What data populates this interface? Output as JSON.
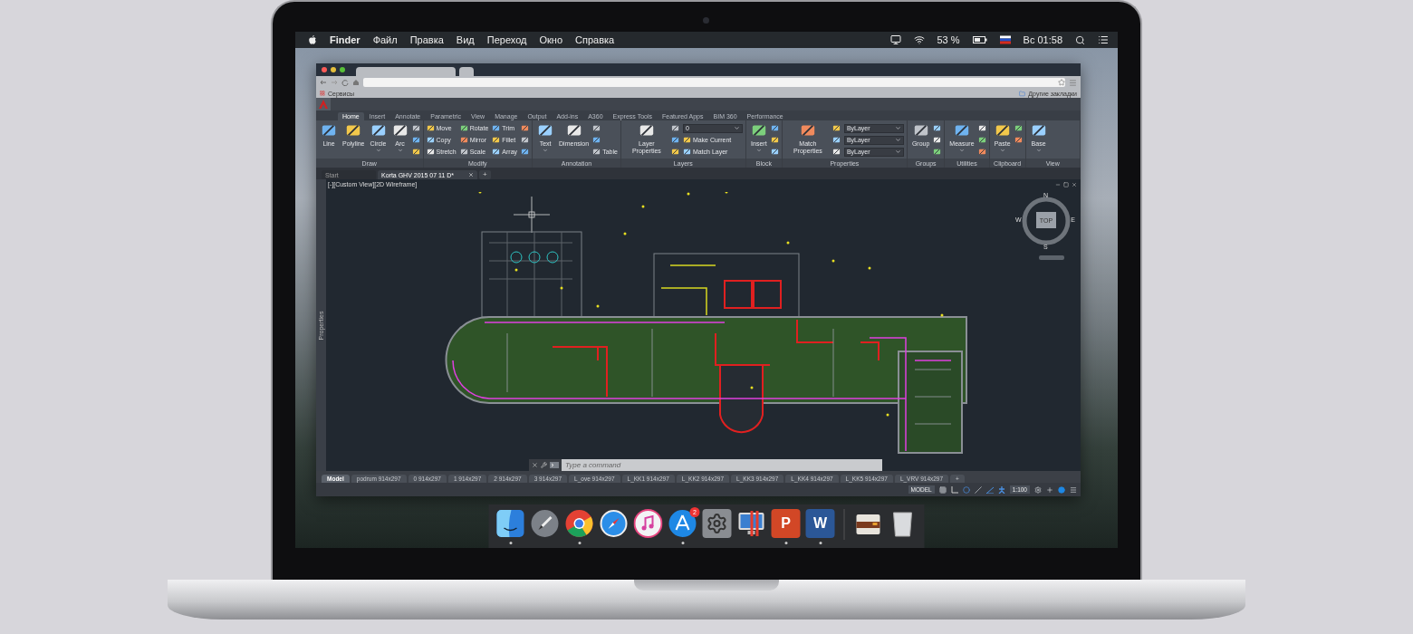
{
  "menu_bar": {
    "items": [
      {
        "label": "Finder",
        "kind": "app"
      },
      {
        "label": "Файл",
        "kind": "menu"
      },
      {
        "label": "Правка",
        "kind": "menu"
      },
      {
        "label": "Вид",
        "kind": "menu"
      },
      {
        "label": "Переход",
        "kind": "menu"
      },
      {
        "label": "Окно",
        "kind": "menu"
      },
      {
        "label": "Справка",
        "kind": "menu"
      }
    ],
    "battery": "53 %",
    "clock": "Вс 01:58"
  },
  "browser": {
    "bookmarks": [
      {
        "label": "Сервисы"
      }
    ],
    "other_bookmarks": "Другие закладки"
  },
  "autocad": {
    "ribbon_tabs": [
      {
        "label": "Home",
        "selected": true
      },
      {
        "label": "Insert",
        "selected": false
      },
      {
        "label": "Annotate",
        "selected": false
      },
      {
        "label": "Parametric",
        "selected": false
      },
      {
        "label": "View",
        "selected": false
      },
      {
        "label": "Manage",
        "selected": false
      },
      {
        "label": "Output",
        "selected": false
      },
      {
        "label": "Add-ins",
        "selected": false
      },
      {
        "label": "A360",
        "selected": false
      },
      {
        "label": "Express Tools",
        "selected": false
      },
      {
        "label": "Featured Apps",
        "selected": false
      },
      {
        "label": "BIM 360",
        "selected": false
      },
      {
        "label": "Performance",
        "selected": false
      }
    ],
    "panels": [
      {
        "title": "Draw",
        "items": [
          {
            "kind": "large",
            "label": "Line",
            "menu": false
          },
          {
            "kind": "large",
            "label": "Polyline",
            "menu": false
          },
          {
            "kind": "large",
            "label": "Circle",
            "menu": true
          },
          {
            "kind": "large",
            "label": "Arc",
            "menu": true
          },
          {
            "kind": "icon"
          },
          {
            "kind": "icon"
          },
          {
            "kind": "icon"
          }
        ]
      },
      {
        "title": "Modify",
        "items": [
          {
            "kind": "small",
            "label": "Move"
          },
          {
            "kind": "small",
            "label": "Copy"
          },
          {
            "kind": "small",
            "label": "Stretch"
          },
          {
            "kind": "small",
            "label": "Rotate"
          },
          {
            "kind": "small",
            "label": "Mirror"
          },
          {
            "kind": "small",
            "label": "Scale"
          },
          {
            "kind": "small",
            "label": "Trim"
          },
          {
            "kind": "small",
            "label": "Fillet"
          },
          {
            "kind": "small",
            "label": "Array"
          },
          {
            "kind": "icon"
          },
          {
            "kind": "icon"
          },
          {
            "kind": "icon"
          }
        ]
      },
      {
        "title": "Annotation",
        "items": [
          {
            "kind": "large",
            "label": "Text",
            "menu": true
          },
          {
            "kind": "large",
            "label": "Dimension",
            "menu": false
          },
          {
            "kind": "icon"
          },
          {
            "kind": "icon"
          },
          {
            "kind": "small",
            "label": "Table"
          }
        ]
      },
      {
        "title": "Layers",
        "items": [
          {
            "kind": "large",
            "label": "Layer Properties",
            "menu": false
          },
          {
            "kind": "icon"
          },
          {
            "kind": "icon"
          },
          {
            "kind": "icon"
          },
          {
            "kind": "dropdown",
            "label": "0"
          },
          {
            "kind": "small",
            "label": "Make Current"
          },
          {
            "kind": "small",
            "label": "Match Layer"
          }
        ]
      },
      {
        "title": "Block",
        "items": [
          {
            "kind": "large",
            "label": "Insert",
            "menu": true
          },
          {
            "kind": "icon"
          },
          {
            "kind": "icon"
          },
          {
            "kind": "icon"
          }
        ]
      },
      {
        "title": "Properties",
        "items": [
          {
            "kind": "large",
            "label": "Match Properties",
            "menu": false
          },
          {
            "kind": "icon"
          },
          {
            "kind": "icon"
          },
          {
            "kind": "icon"
          },
          {
            "kind": "dropdown",
            "label": "ByLayer"
          },
          {
            "kind": "dropdown",
            "label": "ByLayer"
          },
          {
            "kind": "dropdown",
            "label": "ByLayer"
          }
        ]
      },
      {
        "title": "Groups",
        "items": [
          {
            "kind": "large",
            "label": "Group",
            "menu": false
          },
          {
            "kind": "icon"
          },
          {
            "kind": "icon"
          },
          {
            "kind": "icon"
          }
        ]
      },
      {
        "title": "Utilities",
        "items": [
          {
            "kind": "large",
            "label": "Measure",
            "menu": true
          },
          {
            "kind": "icon"
          },
          {
            "kind": "icon"
          },
          {
            "kind": "icon"
          }
        ]
      },
      {
        "title": "Clipboard",
        "items": [
          {
            "kind": "large",
            "label": "Paste",
            "menu": true
          },
          {
            "kind": "icon"
          },
          {
            "kind": "icon"
          }
        ]
      },
      {
        "title": "View",
        "items": [
          {
            "kind": "large",
            "label": "Base",
            "menu": true
          }
        ]
      }
    ],
    "doc_tabs": [
      {
        "label": "Start",
        "selected": false
      },
      {
        "label": "Korta GHV 2015 07 11 D*",
        "selected": true
      }
    ],
    "new_tab": "+",
    "viewport_label": "[-][Custom View][2D Wireframe]",
    "palette_label": "Properties",
    "viewcube": {
      "north": "N",
      "east": "E",
      "south": "S",
      "west": "W",
      "face": "TOP"
    },
    "command_placeholder": "Type a command",
    "layout_tabs": [
      {
        "label": "Model",
        "selected": true
      },
      {
        "label": "podrum 914x297",
        "selected": false
      },
      {
        "label": "0 914x297",
        "selected": false
      },
      {
        "label": "1 914x297",
        "selected": false
      },
      {
        "label": "2 914x297",
        "selected": false
      },
      {
        "label": "3 914x297",
        "selected": false
      },
      {
        "label": "L_ove 914x297",
        "selected": false
      },
      {
        "label": "L_KK1 914x297",
        "selected": false
      },
      {
        "label": "L_KK2 914x297",
        "selected": false
      },
      {
        "label": "L_KK3 914x297",
        "selected": false
      },
      {
        "label": "L_KK4 914x297",
        "selected": false
      },
      {
        "label": "L_KK5 914x297",
        "selected": false
      },
      {
        "label": "L_VRV 914x297",
        "selected": false
      }
    ],
    "new_layout": "+",
    "status": {
      "mode": "MODEL",
      "scale": "1:100"
    }
  },
  "dock": {
    "items": [
      {
        "kind": "finder",
        "running": true
      },
      {
        "kind": "launchpad",
        "running": false
      },
      {
        "kind": "chrome",
        "running": true
      },
      {
        "kind": "safari",
        "running": false
      },
      {
        "kind": "music",
        "running": false
      },
      {
        "kind": "appstore",
        "running": true,
        "badge": "2"
      },
      {
        "kind": "settings",
        "running": false
      },
      {
        "kind": "vm",
        "running": false
      },
      {
        "kind": "slides",
        "running": true,
        "glyph": "P"
      },
      {
        "kind": "docs",
        "running": true,
        "glyph": "W"
      },
      {
        "kind": "separator"
      },
      {
        "kind": "archive",
        "running": false
      },
      {
        "kind": "trash",
        "running": false
      }
    ]
  }
}
